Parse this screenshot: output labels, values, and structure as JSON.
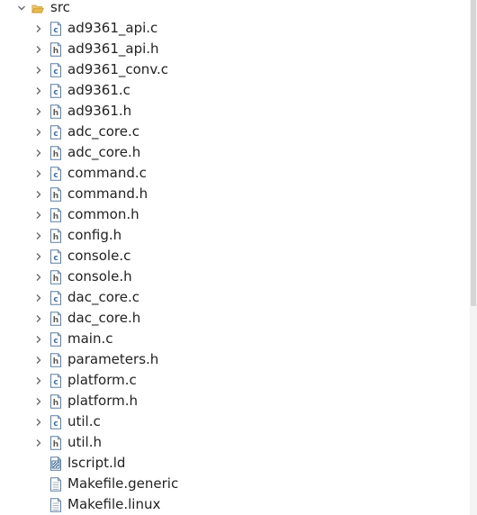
{
  "tree": {
    "root": {
      "label": "src",
      "icon": "folder-open-icon",
      "expanded": true
    },
    "items": [
      {
        "label": "ad9361_api.c",
        "icon": "c-source-file-icon",
        "expandable": true
      },
      {
        "label": "ad9361_api.h",
        "icon": "c-header-file-icon",
        "expandable": true
      },
      {
        "label": "ad9361_conv.c",
        "icon": "c-source-file-icon",
        "expandable": true
      },
      {
        "label": "ad9361.c",
        "icon": "c-source-file-icon",
        "expandable": true
      },
      {
        "label": "ad9361.h",
        "icon": "c-header-file-icon",
        "expandable": true
      },
      {
        "label": "adc_core.c",
        "icon": "c-source-file-icon",
        "expandable": true
      },
      {
        "label": "adc_core.h",
        "icon": "c-header-file-icon",
        "expandable": true
      },
      {
        "label": "command.c",
        "icon": "c-source-file-icon",
        "expandable": true
      },
      {
        "label": "command.h",
        "icon": "c-header-file-icon",
        "expandable": true
      },
      {
        "label": "common.h",
        "icon": "c-header-file-icon",
        "expandable": true
      },
      {
        "label": "config.h",
        "icon": "c-header-file-icon",
        "expandable": true
      },
      {
        "label": "console.c",
        "icon": "c-source-file-icon",
        "expandable": true
      },
      {
        "label": "console.h",
        "icon": "c-header-file-icon",
        "expandable": true
      },
      {
        "label": "dac_core.c",
        "icon": "c-source-file-icon",
        "expandable": true
      },
      {
        "label": "dac_core.h",
        "icon": "c-header-file-icon",
        "expandable": true
      },
      {
        "label": "main.c",
        "icon": "c-source-file-icon",
        "expandable": true
      },
      {
        "label": "parameters.h",
        "icon": "c-header-file-icon",
        "expandable": true
      },
      {
        "label": "platform.c",
        "icon": "c-source-file-icon",
        "expandable": true
      },
      {
        "label": "platform.h",
        "icon": "c-header-file-icon",
        "expandable": true
      },
      {
        "label": "util.c",
        "icon": "c-source-file-icon",
        "expandable": true
      },
      {
        "label": "util.h",
        "icon": "c-header-file-icon",
        "expandable": true
      },
      {
        "label": "lscript.ld",
        "icon": "linker-script-file-icon",
        "expandable": false
      },
      {
        "label": "Makefile.generic",
        "icon": "text-file-icon",
        "expandable": false
      },
      {
        "label": "Makefile.linux",
        "icon": "text-file-icon",
        "expandable": false
      }
    ]
  },
  "colors": {
    "text": "#222222",
    "chevron": "#6b6b6b",
    "folder": "#e8b84a",
    "file_border": "#5a7fa6",
    "c_letter": "#3a6fb0",
    "h_letter": "#5a5a5a"
  }
}
